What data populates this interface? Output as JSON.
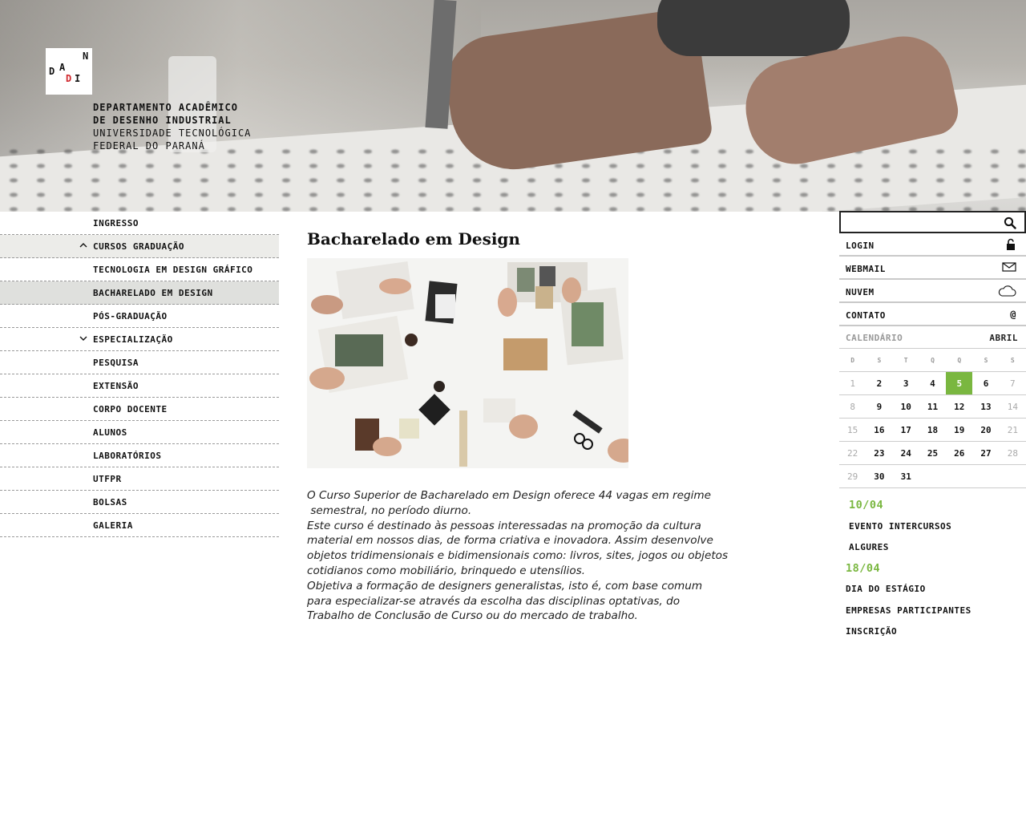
{
  "header": {
    "logo_letters": [
      "N",
      "D",
      "A",
      "D",
      "I"
    ],
    "dept_lines": [
      "DEPARTAMENTO ACADÊMICO",
      "DE DESENHO INDUSTRIAL",
      "UNIVERSIDADE TECNOLÓGICA",
      "FEDERAL DO PARANÁ"
    ]
  },
  "nav": {
    "items": [
      {
        "label": "INGRESSO"
      },
      {
        "label": "CURSOS GRADUAÇÃO",
        "chevron": "up"
      },
      {
        "label": "TECNOLOGIA EM DESIGN GRÁFICO"
      },
      {
        "label": "BACHARELADO EM DESIGN"
      },
      {
        "label": "PÓS-GRADUAÇÃO"
      },
      {
        "label": "ESPECIALIZAÇÃO",
        "chevron": "down"
      },
      {
        "label": "PESQUISA"
      },
      {
        "label": "EXTENSÃO"
      },
      {
        "label": "CORPO DOCENTE"
      },
      {
        "label": "ALUNOS"
      },
      {
        "label": "LABORATÓRIOS"
      },
      {
        "label": "UTFPR"
      },
      {
        "label": "BOLSAS"
      },
      {
        "label": "GALERIA"
      }
    ]
  },
  "main": {
    "title": "Bacharelado em Design",
    "intro_lines": [
      "O Curso Superior de Bacharelado em Design oferece 44 vagas em regime",
      " semestral, no período diurno.",
      "Este curso é destinado às pessoas interessadas na promoção da cultura",
      "material em nossos dias, de forma criativa e inovadora. Assim desenvolve",
      "objetos tridimensionais e bidimensionais como: livros, sites, jogos ou objetos",
      "cotidianos como mobiliário, brinquedo e utensílios.",
      "Objetiva a formação de designers generalistas, isto é, com base comum",
      "para especializar-se através da escolha das disciplinas optativas, do",
      "Trabalho de Conclusão de Curso ou do mercado de trabalho."
    ]
  },
  "sidebar": {
    "search_placeholder": "",
    "search_icon": "search-icon",
    "utilities": [
      {
        "label": "LOGIN",
        "icon": "lock-icon"
      },
      {
        "label": "WEBMAIL",
        "icon": "envelope-icon"
      },
      {
        "label": "NUVEM",
        "icon": "cloud-icon"
      },
      {
        "label": "CONTATO",
        "icon": "at-icon",
        "glyph": "@"
      }
    ]
  },
  "calendar": {
    "title": "CALENDÁRIO",
    "month": "ABRIL",
    "weekdays": [
      "D",
      "S",
      "T",
      "Q",
      "Q",
      "S",
      "S"
    ],
    "today": "5",
    "accent_color": "#7ab740",
    "weeks": [
      [
        "1",
        "2",
        "3",
        "4",
        "5",
        "6",
        "7"
      ],
      [
        "8",
        "9",
        "10",
        "11",
        "12",
        "13",
        "14"
      ],
      [
        "15",
        "16",
        "17",
        "18",
        "19",
        "20",
        "21"
      ],
      [
        "22",
        "23",
        "24",
        "25",
        "26",
        "27",
        "28"
      ],
      [
        "29",
        "30",
        "31",
        "",
        "",
        "",
        ""
      ]
    ]
  },
  "events": [
    {
      "date": "10/04",
      "lines": [
        "EVENTO INTERCURSOS",
        "ALGURES"
      ]
    },
    {
      "date": "18/04",
      "lines": [
        "DIA DO ESTÁGIO",
        "EMPRESAS PARTICIPANTES",
        "INSCRIÇÃO"
      ]
    }
  ]
}
